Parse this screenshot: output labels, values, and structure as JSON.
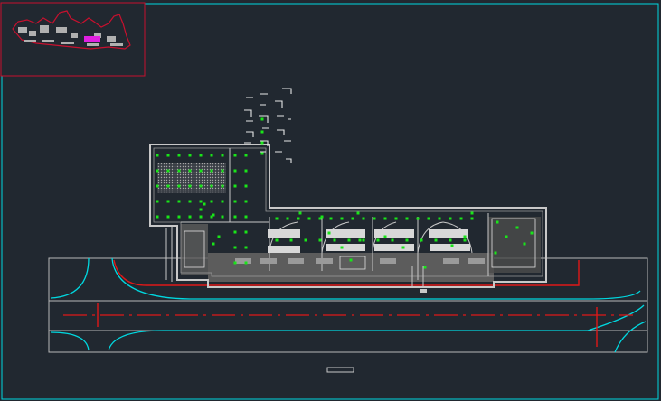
{
  "app": {
    "background": "#212830",
    "viewport_border_color": "#00d8e0"
  },
  "colors": {
    "wall": "#c8c8c8",
    "hatch": "#6e6e6e",
    "light_fixture": "#19e619",
    "curb": "#e01818",
    "road_edge": "#00d8e0",
    "road_line": "#b8b8b8",
    "navigator_border": "#c8102e",
    "navigator_highlight": "#e020e0"
  },
  "icons": {
    "scale_bar": "scale-bar-icon",
    "site_thumbnail": "site-outline-icon"
  }
}
